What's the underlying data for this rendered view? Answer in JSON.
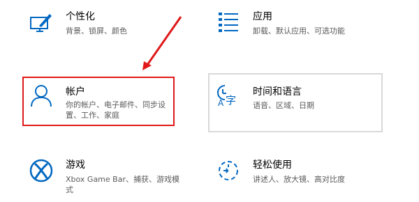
{
  "tiles": {
    "personalization": {
      "title": "个性化",
      "desc": "背景、锁屏、颜色",
      "icon": "personalization-icon"
    },
    "apps": {
      "title": "应用",
      "desc": "卸载、默认应用、可选功能",
      "icon": "apps-list-icon"
    },
    "accounts": {
      "title": "帐户",
      "desc": "你的帐户、电子邮件、同步设置、工作、家庭",
      "icon": "person-icon"
    },
    "time_language": {
      "title": "时间和语言",
      "desc": "语音、区域、日期",
      "icon": "time-language-icon"
    },
    "gaming": {
      "title": "游戏",
      "desc": "Xbox Game Bar、捕获、游戏模式",
      "icon": "xbox-icon"
    },
    "ease_of_access": {
      "title": "轻松使用",
      "desc": "讲述人、放大镜、高对比度",
      "icon": "ease-of-access-icon"
    }
  },
  "colors": {
    "accent": "#0067c0",
    "highlight_border": "#e01818",
    "hover_border": "#d9d9d9",
    "annotation_arrow": "#e01818"
  }
}
